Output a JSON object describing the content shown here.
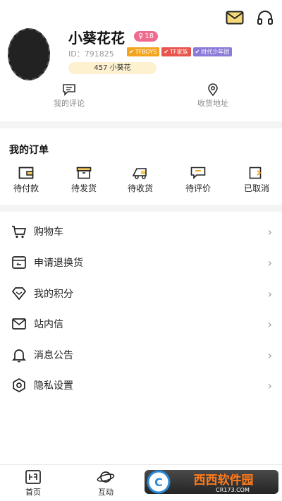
{
  "profile": {
    "username": "小葵花花",
    "level": "18",
    "user_id": "ID：791825",
    "tags": [
      {
        "label": "TFBOYS",
        "color": "#f3a51f"
      },
      {
        "label": "TF家族",
        "color": "#e9544d"
      },
      {
        "label": "时代少年团",
        "color": "#8b7ad8"
      }
    ],
    "fan_label": "457 小葵花"
  },
  "quick_links": [
    {
      "label": "我的评论",
      "icon": "comment-icon"
    },
    {
      "label": "收货地址",
      "icon": "location-icon"
    }
  ],
  "orders": {
    "title": "我的订单",
    "items": [
      {
        "label": "待付款",
        "icon": "wallet-icon"
      },
      {
        "label": "待发货",
        "icon": "box-icon"
      },
      {
        "label": "待收货",
        "icon": "truck-icon"
      },
      {
        "label": "待评价",
        "icon": "comment-icon"
      },
      {
        "label": "已取消",
        "icon": "cancel-icon"
      }
    ]
  },
  "menu": [
    {
      "label": "购物车",
      "icon": "cart-icon"
    },
    {
      "label": "申请退换货",
      "icon": "return-icon"
    },
    {
      "label": "我的积分",
      "icon": "diamond-icon"
    },
    {
      "label": "站内信",
      "icon": "mail-icon"
    },
    {
      "label": "消息公告",
      "icon": "bell-icon"
    },
    {
      "label": "隐私设置",
      "icon": "settings-icon"
    }
  ],
  "chevron": "›",
  "bottom_nav": [
    {
      "label": "首页",
      "icon": "home-icon"
    },
    {
      "label": "互动",
      "icon": "planet-icon"
    }
  ],
  "watermark": {
    "title": "西西软件园",
    "url": "CR173.COM"
  },
  "colors": {
    "level_badge": "#f06a8e",
    "fan_pill": "#fdf1d0"
  }
}
